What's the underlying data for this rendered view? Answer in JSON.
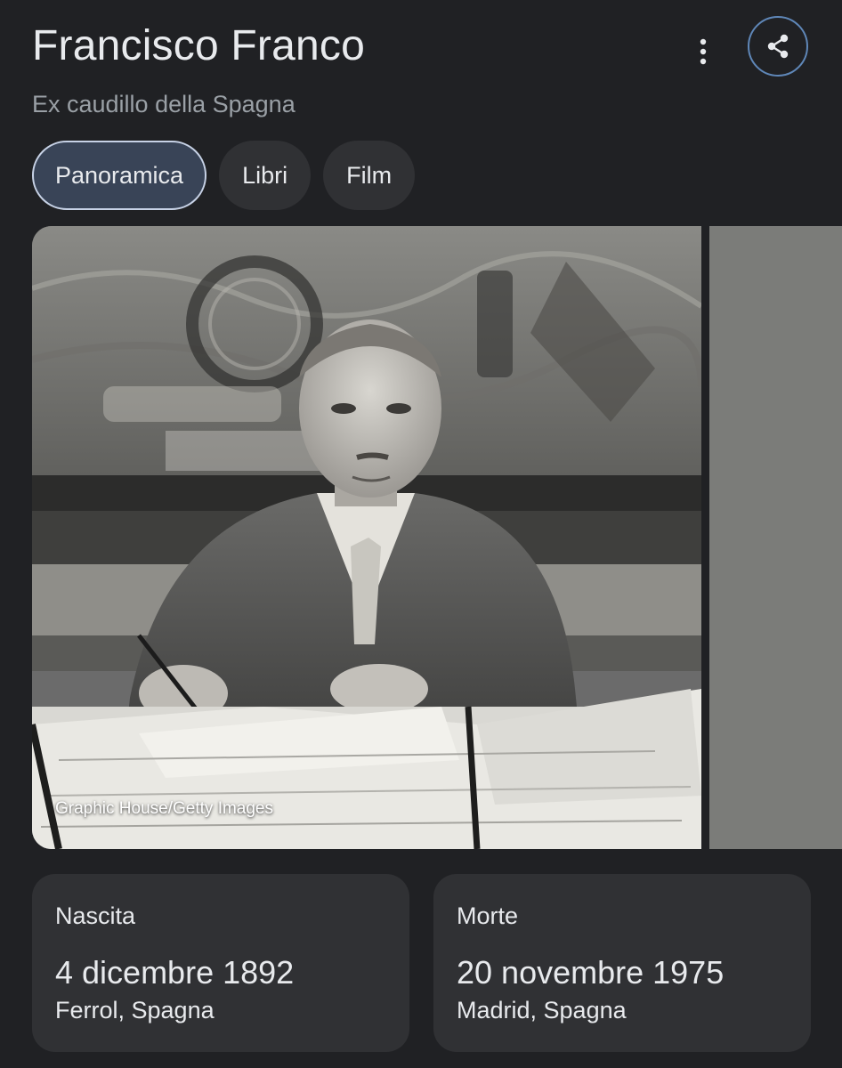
{
  "header": {
    "title": "Francisco Franco",
    "subtitle": "Ex caudillo della Spagna",
    "more_icon": "more-vert-icon",
    "share_icon": "share-icon"
  },
  "tabs": [
    {
      "label": "Panoramica",
      "active": true
    },
    {
      "label": "Libri",
      "active": false
    },
    {
      "label": "Film",
      "active": false
    }
  ],
  "image": {
    "credit": "Graphic House/Getty Images"
  },
  "facts": {
    "birth": {
      "label": "Nascita",
      "date": "4 dicembre 1892",
      "place": "Ferrol, Spagna"
    },
    "death": {
      "label": "Morte",
      "date": "20 novembre 1975",
      "place": "Madrid, Spagna"
    }
  },
  "colors": {
    "background": "#202124",
    "card": "#303134",
    "active_tab": "#394457",
    "share_border": "#5f87b8"
  }
}
